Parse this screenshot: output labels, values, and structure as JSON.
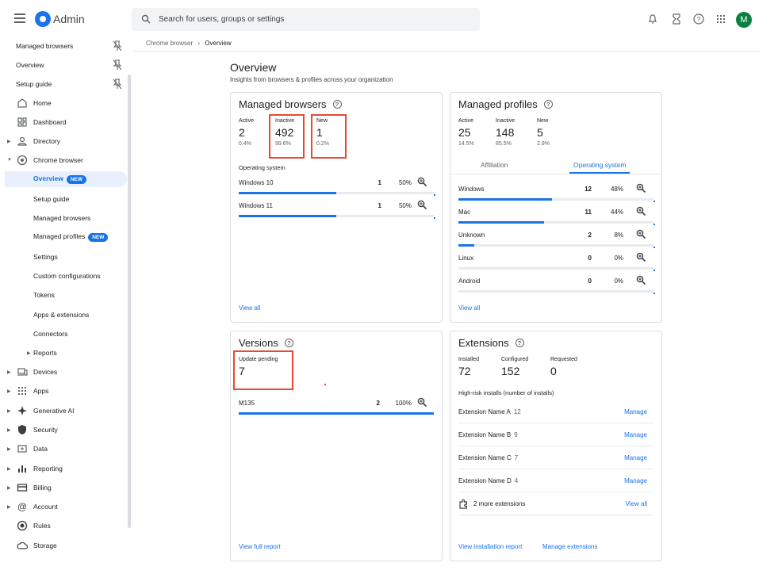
{
  "header": {
    "app_title": "Admin",
    "search_placeholder": "Search for users, groups or settings",
    "avatar_initial": "M"
  },
  "sidebar": {
    "pinned": [
      "Managed browsers",
      "Overview",
      "Setup guide"
    ],
    "items": [
      {
        "label": "Home",
        "icon": "home-icon"
      },
      {
        "label": "Dashboard",
        "icon": "dashboard-icon"
      },
      {
        "label": "Directory",
        "icon": "person-icon"
      },
      {
        "label": "Chrome browser",
        "icon": "chrome-icon"
      }
    ],
    "chrome_sub": [
      {
        "label": "Overview",
        "badge": "NEW"
      },
      {
        "label": "Setup guide"
      },
      {
        "label": "Managed browsers"
      },
      {
        "label": "Managed profiles",
        "badge": "NEW"
      },
      {
        "label": "Settings"
      },
      {
        "label": "Custom configurations"
      },
      {
        "label": "Tokens"
      },
      {
        "label": "Apps & extensions"
      },
      {
        "label": "Connectors"
      },
      {
        "label": "Reports"
      }
    ],
    "bottom": [
      {
        "label": "Devices",
        "icon": "devices-icon"
      },
      {
        "label": "Apps",
        "icon": "apps-grid-icon"
      },
      {
        "label": "Generative AI",
        "icon": "sparkle-icon"
      },
      {
        "label": "Security",
        "icon": "shield-icon"
      },
      {
        "label": "Data",
        "icon": "data-icon"
      },
      {
        "label": "Reporting",
        "icon": "bar-chart-icon"
      },
      {
        "label": "Billing",
        "icon": "card-icon"
      },
      {
        "label": "Account",
        "icon": "at-icon"
      },
      {
        "label": "Rules",
        "icon": "rules-icon"
      },
      {
        "label": "Storage",
        "icon": "cloud-icon"
      }
    ]
  },
  "breadcrumb": {
    "parent": "Chrome browser",
    "sep": "›",
    "current": "Overview"
  },
  "page": {
    "title": "Overview",
    "subtitle": "Insights from browsers & profiles across your organization"
  },
  "managed_browsers": {
    "title": "Managed browsers",
    "stats": [
      {
        "label": "Active",
        "value": "2",
        "pct": "0.4%"
      },
      {
        "label": "Inactive",
        "value": "492",
        "pct": "99.6%"
      },
      {
        "label": "New",
        "value": "1",
        "pct": "0.2%"
      }
    ],
    "section": "Operating system",
    "rows": [
      {
        "name": "Windows 10",
        "count": "1",
        "pct": "50%",
        "fill": 0.5
      },
      {
        "name": "Windows 11",
        "count": "1",
        "pct": "50%",
        "fill": 0.5
      }
    ],
    "view_all": "View all"
  },
  "managed_profiles": {
    "title": "Managed profiles",
    "stats": [
      {
        "label": "Active",
        "value": "25",
        "pct": "14.5%"
      },
      {
        "label": "Inactive",
        "value": "148",
        "pct": "85.5%"
      },
      {
        "label": "New",
        "value": "5",
        "pct": "2.9%"
      }
    ],
    "tabs": [
      "Affiliation",
      "Operating system"
    ],
    "rows": [
      {
        "name": "Windows",
        "count": "12",
        "pct": "48%",
        "fill": 0.48
      },
      {
        "name": "Mac",
        "count": "11",
        "pct": "44%",
        "fill": 0.44
      },
      {
        "name": "Unknown",
        "count": "2",
        "pct": "8%",
        "fill": 0.08
      },
      {
        "name": "Linux",
        "count": "0",
        "pct": "0%",
        "fill": 0
      },
      {
        "name": "Android",
        "count": "0",
        "pct": "0%",
        "fill": 0
      }
    ],
    "view_all": "View all"
  },
  "versions": {
    "title": "Versions",
    "stat_label": "Update pending",
    "stat_value": "7",
    "rows": [
      {
        "name": "M135",
        "count": "2",
        "pct": "100%",
        "fill": 1.0
      }
    ],
    "view_full": "View full report"
  },
  "extensions": {
    "title": "Extensions",
    "stats": [
      {
        "label": "Installed",
        "value": "72"
      },
      {
        "label": "Configured",
        "value": "152"
      },
      {
        "label": "Requested",
        "value": "0"
      }
    ],
    "section": "High-risk installs (number of installs)",
    "rows": [
      {
        "name": "Extension Name A",
        "count": "12",
        "action": "Manage"
      },
      {
        "name": "Extension Name B",
        "count": "9",
        "action": "Manage"
      },
      {
        "name": "Extension Name C",
        "count": "7",
        "action": "Manage"
      },
      {
        "name": "Extension Name D",
        "count": "4",
        "action": "Manage"
      }
    ],
    "more": "2 more extensions",
    "more_action": "View all",
    "link_report": "View installation report",
    "link_manage": "Manage extensions"
  },
  "colors": {
    "accent": "#1a73e8",
    "highlight": "#e8492f",
    "avatar": "#0b8043"
  }
}
